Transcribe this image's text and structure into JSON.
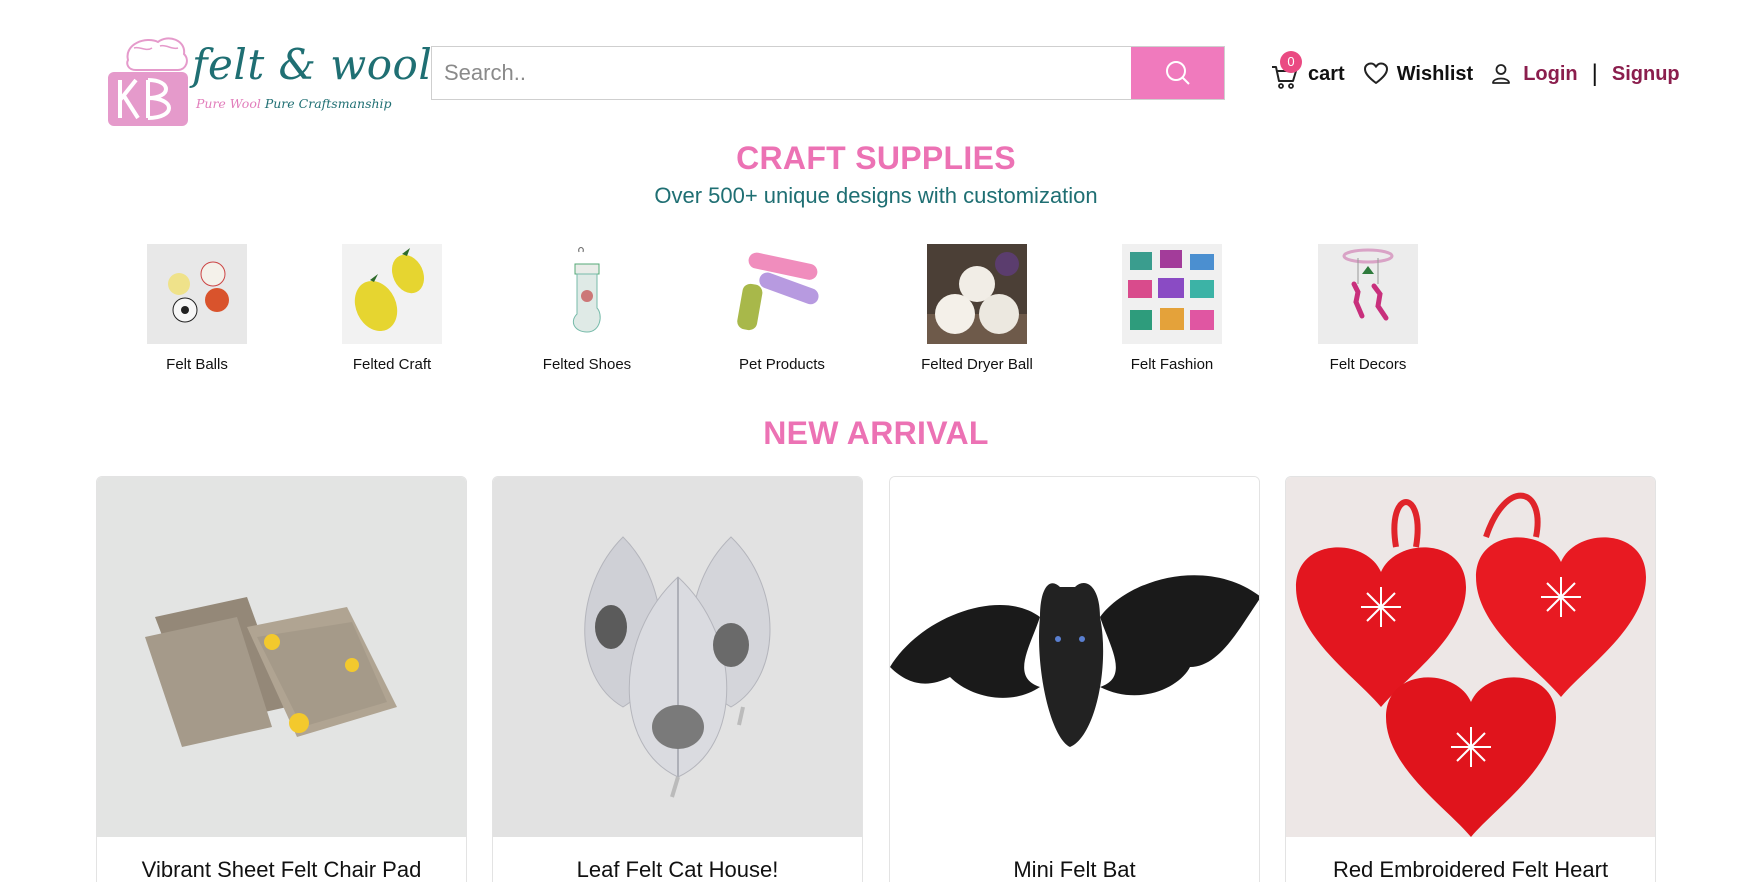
{
  "header": {
    "logo": {
      "brand_name": "felt & wool",
      "tagline_pink": "Pure Wool",
      "tagline_teal": "Pure Craftsmanship",
      "monogram": "KB"
    },
    "search": {
      "placeholder": "Search.."
    },
    "cart": {
      "label": "cart",
      "count": "0"
    },
    "wishlist": {
      "label": "Wishlist"
    },
    "login": {
      "label": "Login"
    },
    "divider": "|",
    "signup": {
      "label": "Signup"
    }
  },
  "craft_supplies": {
    "title": "CRAFT SUPPLIES",
    "subtitle": "Over 500+ unique designs with customization",
    "categories": [
      {
        "label": "Felt Balls"
      },
      {
        "label": "Felted Craft"
      },
      {
        "label": "Felted Shoes"
      },
      {
        "label": "Pet Products"
      },
      {
        "label": "Felted Dryer Ball"
      },
      {
        "label": "Felt Fashion"
      },
      {
        "label": "Felt Decors"
      }
    ]
  },
  "new_arrival": {
    "title": "NEW ARRIVAL",
    "products": [
      {
        "title": "Vibrant Sheet Felt Chair Pad"
      },
      {
        "title": "Leaf Felt Cat House!"
      },
      {
        "title": "Mini Felt Bat"
      },
      {
        "title": "Red Embroidered Felt Heart"
      }
    ]
  },
  "colors": {
    "accent_pink": "#ec72b4",
    "search_button": "#f07abd",
    "teal": "#1f6f73",
    "auth_link": "#8b1e4d",
    "badge": "#ea4a82"
  }
}
